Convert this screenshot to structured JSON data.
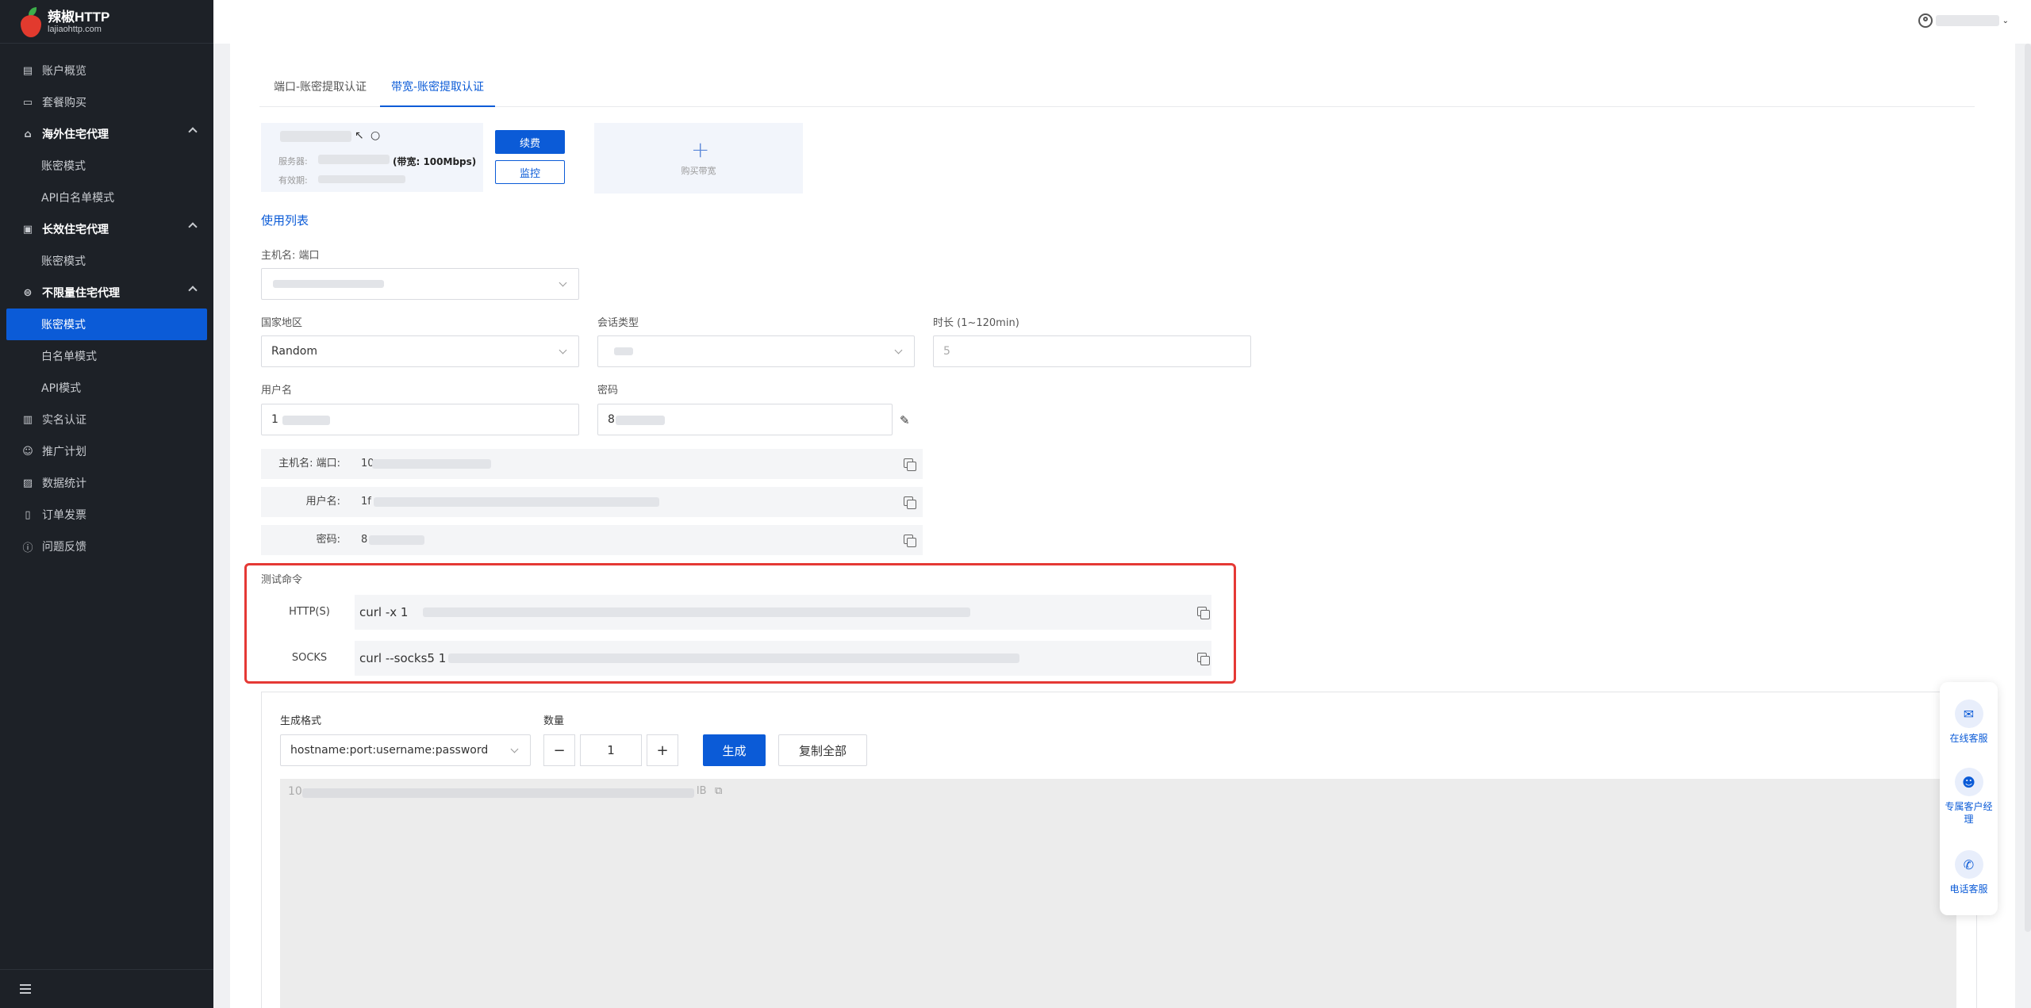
{
  "brand": {
    "name": "辣椒HTTP",
    "url": "lajiaohttp.com"
  },
  "sidebar": {
    "items": [
      {
        "label": "账户概览",
        "icon": "dashboard-icon",
        "type": "item"
      },
      {
        "label": "套餐购买",
        "icon": "wallet-icon",
        "type": "item"
      },
      {
        "label": "海外住宅代理",
        "icon": "house-icon",
        "type": "group"
      },
      {
        "label": "账密模式",
        "type": "sub"
      },
      {
        "label": "API白名单模式",
        "type": "sub"
      },
      {
        "label": "长效住宅代理",
        "icon": "monitor-icon",
        "type": "group"
      },
      {
        "label": "账密模式",
        "type": "sub"
      },
      {
        "label": "不限量住宅代理",
        "icon": "router-icon",
        "type": "group"
      },
      {
        "label": "账密模式",
        "type": "sub-active"
      },
      {
        "label": "白名单模式",
        "type": "sub"
      },
      {
        "label": "API模式",
        "type": "sub"
      },
      {
        "label": "实名认证",
        "icon": "id-card-icon",
        "type": "item"
      },
      {
        "label": "推广计划",
        "icon": "users-icon",
        "type": "item"
      },
      {
        "label": "数据统计",
        "icon": "chart-icon",
        "type": "item"
      },
      {
        "label": "订单发票",
        "icon": "receipt-icon",
        "type": "item"
      },
      {
        "label": "问题反馈",
        "icon": "alert-icon",
        "type": "item"
      }
    ]
  },
  "tabs": [
    {
      "label": "端口-账密提取认证",
      "active": false
    },
    {
      "label": "带宽-账密提取认证",
      "active": true
    }
  ],
  "account_card": {
    "server_label": "服务器:",
    "bandwidth": "(带宽: 100Mbps)",
    "expiry_label": "有效期:",
    "renew_label": "续费",
    "monitor_label": "监控",
    "buy_label": "购买带宽"
  },
  "usage": {
    "title": "使用列表",
    "host_port_label": "主机名: 端口",
    "country_label": "国家地区",
    "country_value": "Random",
    "session_label": "会话类型",
    "duration_label": "时长 (1~120min)",
    "duration_value": "5",
    "username_label": "用户名",
    "username_value": "1",
    "password_label": "密码",
    "password_value": "8"
  },
  "info_rows": [
    {
      "label": "主机名: 端口:",
      "value": "10"
    },
    {
      "label": "用户名:",
      "value": "1f"
    },
    {
      "label": "密码:",
      "value": "8"
    }
  ],
  "test": {
    "title": "测试命令",
    "rows": [
      {
        "label": "HTTP(S)",
        "value": "curl -x 1"
      },
      {
        "label": "SOCKS",
        "value": "curl --socks5 1"
      }
    ]
  },
  "generator": {
    "format_label": "生成格式",
    "format_value": "hostname:port:username:password",
    "quantity_label": "数量",
    "quantity_value": "1",
    "minus": "−",
    "plus": "+",
    "generate_label": "生成",
    "copy_all_label": "复制全部",
    "output_prefix": "10",
    "output_suffix": "lB"
  },
  "support": [
    {
      "label": "在线客服",
      "icon": "chat-icon"
    },
    {
      "label": "专属客户经理",
      "icon": "agent-icon"
    },
    {
      "label": "电话客服",
      "icon": "phone-icon"
    }
  ],
  "colors": {
    "accent": "#0b5bd7",
    "sidebar": "#1d2127",
    "highlight": "#e53935"
  }
}
